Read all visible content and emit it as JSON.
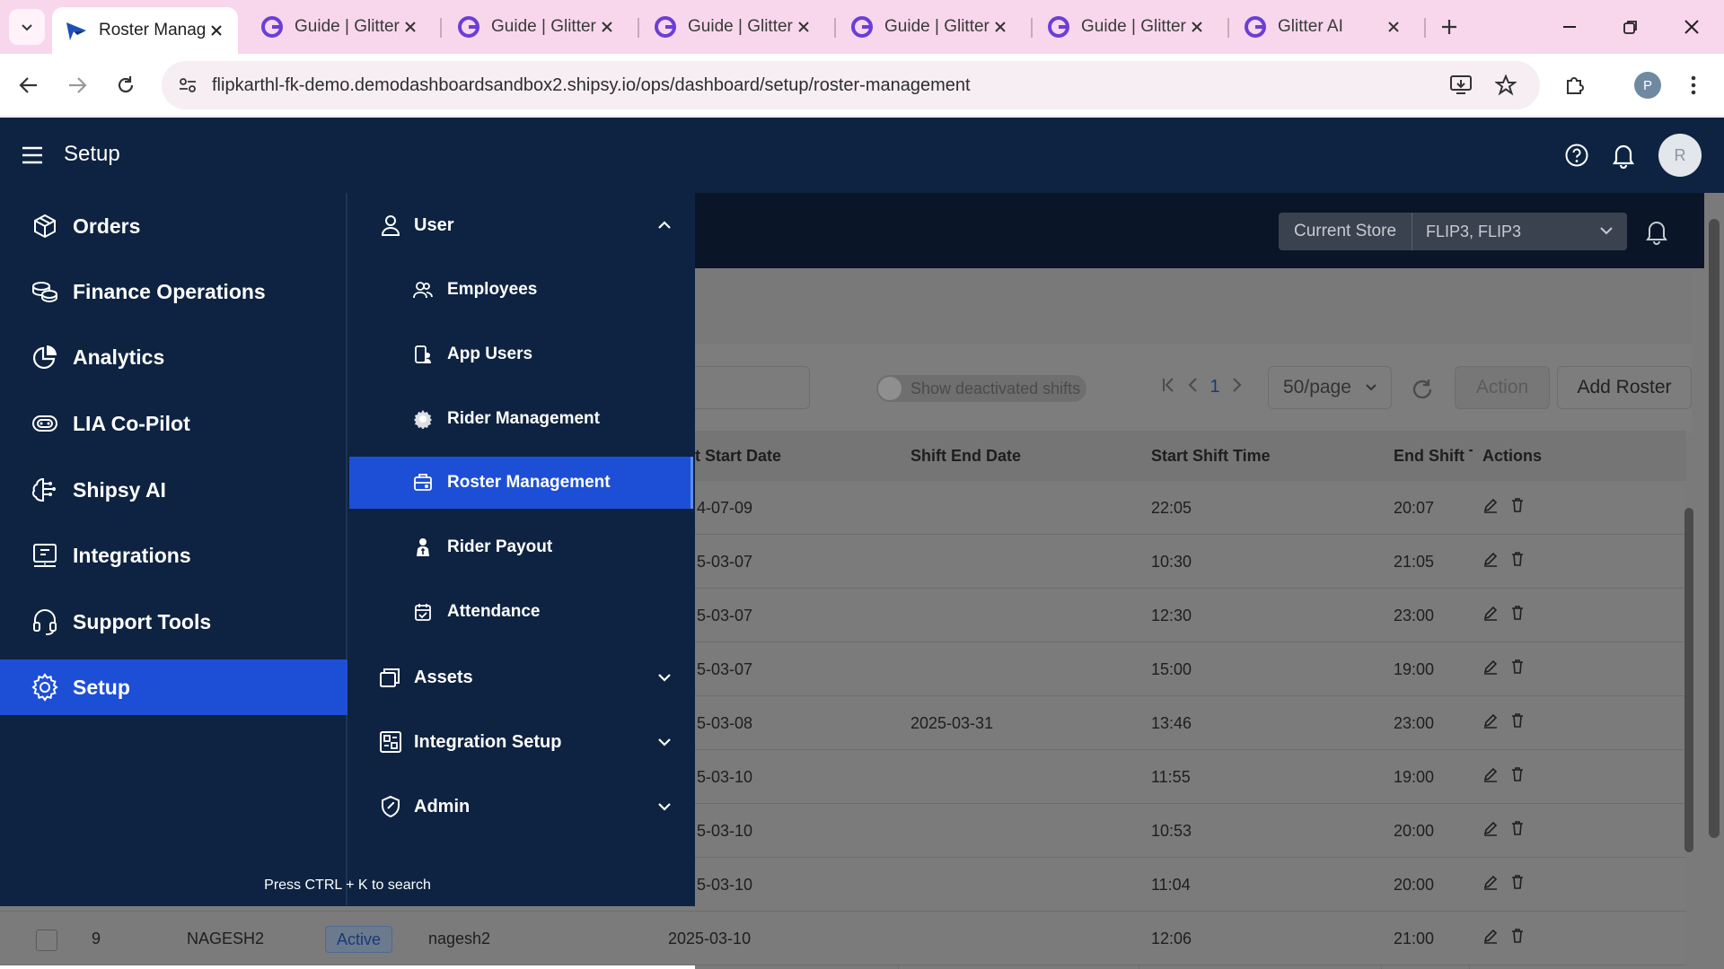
{
  "browser": {
    "tabs": [
      {
        "title": "Roster Manag",
        "active": true,
        "icon": "shipsy-logo-icon"
      },
      {
        "title": "Guide | Glitter",
        "active": false,
        "icon": "glitter-logo-icon"
      },
      {
        "title": "Guide | Glitter",
        "active": false,
        "icon": "glitter-logo-icon"
      },
      {
        "title": "Guide | Glitter",
        "active": false,
        "icon": "glitter-logo-icon"
      },
      {
        "title": "Guide | Glitter",
        "active": false,
        "icon": "glitter-logo-icon"
      },
      {
        "title": "Guide | Glitter",
        "active": false,
        "icon": "glitter-logo-icon"
      },
      {
        "title": "Glitter AI",
        "active": false,
        "icon": "glitter-logo-icon"
      }
    ],
    "url": "flipkarthl-fk-demo.demodashboardsandbox2.shipsy.io/ops/dashboard/setup/roster-management",
    "profile_initial": "P"
  },
  "header": {
    "title": "Setup",
    "avatar_initial": "R"
  },
  "store": {
    "label": "Current Store",
    "value": "FLIP3, FLIP3"
  },
  "toolbar": {
    "toggle_label": "Show deactivated shifts",
    "page_number": "1",
    "per_page": "50/page",
    "action_label": "Action",
    "add_label": "Add Roster"
  },
  "table": {
    "columns": [
      "t Start Date",
      "Shift End Date",
      "Start Shift Time",
      "End Shift T",
      "Actions"
    ],
    "rows": [
      {
        "start_date": "4-07-09",
        "end_date": "",
        "start_time": "22:05",
        "end_time": "20:07"
      },
      {
        "start_date": "5-03-07",
        "end_date": "",
        "start_time": "10:30",
        "end_time": "21:05"
      },
      {
        "start_date": "5-03-07",
        "end_date": "",
        "start_time": "12:30",
        "end_time": "23:00"
      },
      {
        "start_date": "5-03-07",
        "end_date": "",
        "start_time": "15:00",
        "end_time": "19:00"
      },
      {
        "start_date": "5-03-08",
        "end_date": "2025-03-31",
        "start_time": "13:46",
        "end_time": "23:00"
      },
      {
        "start_date": "5-03-10",
        "end_date": "",
        "start_time": "11:55",
        "end_time": "19:00"
      },
      {
        "start_date": "5-03-10",
        "end_date": "",
        "start_time": "10:53",
        "end_time": "20:00"
      },
      {
        "start_date": "5-03-10",
        "end_date": "",
        "start_time": "11:04",
        "end_time": "20:00"
      }
    ],
    "last_row": {
      "index": "9",
      "code": "NAGESH2",
      "status": "Active",
      "name": "nagesh2",
      "start_date": "2025-03-10",
      "start_time": "12:06",
      "end_time": "21:00"
    }
  },
  "sidebar": {
    "items": [
      {
        "label": "Orders",
        "icon": "box-icon"
      },
      {
        "label": "Finance Operations",
        "icon": "coins-icon"
      },
      {
        "label": "Analytics",
        "icon": "pie-chart-icon"
      },
      {
        "label": "LIA Co-Pilot",
        "icon": "copilot-icon"
      },
      {
        "label": "Shipsy AI",
        "icon": "ai-brain-icon"
      },
      {
        "label": "Integrations",
        "icon": "integrations-icon"
      },
      {
        "label": "Support Tools",
        "icon": "headset-icon"
      },
      {
        "label": "Setup",
        "icon": "gear-icon",
        "active": true
      }
    ]
  },
  "submenu": {
    "user_group": "User",
    "items": [
      {
        "label": "Employees",
        "icon": "employees-icon"
      },
      {
        "label": "App Users",
        "icon": "app-users-icon"
      },
      {
        "label": "Rider Management",
        "icon": "rider-management-icon"
      },
      {
        "label": "Roster Management",
        "icon": "roster-icon",
        "active": true
      },
      {
        "label": "Rider Payout",
        "icon": "rider-payout-icon"
      },
      {
        "label": "Attendance",
        "icon": "attendance-icon"
      }
    ],
    "groups": [
      {
        "label": "Assets",
        "icon": "assets-icon"
      },
      {
        "label": "Integration Setup",
        "icon": "integration-setup-icon"
      },
      {
        "label": "Admin",
        "icon": "admin-shield-icon"
      }
    ],
    "search_hint": "Press CTRL + K to search"
  },
  "colors": {
    "nav_bg": "#0e2341",
    "active_blue": "#1d4fd6",
    "tabbar_pink": "#f8d7ec"
  }
}
